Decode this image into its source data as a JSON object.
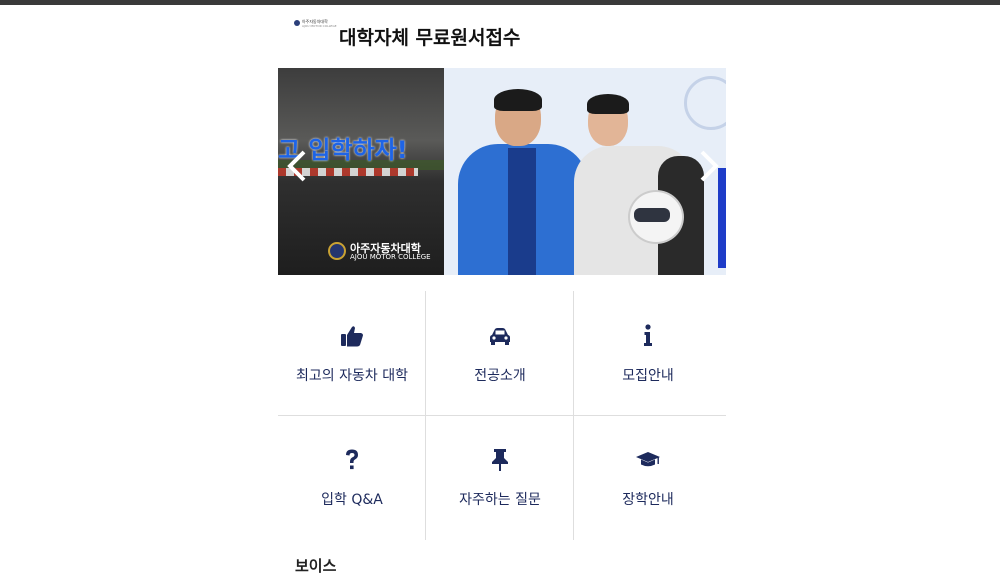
{
  "header": {
    "logo_line1": "아주자동차대학",
    "logo_line2": "AJOU MOTOR COLLEGE",
    "title": "대학자체 무료원서접수"
  },
  "banner": {
    "slogan": "고 입학하자!",
    "brand_kr": "아주자동차대학",
    "brand_en": "AJOU MOTOR COLLEGE",
    "prev_icon": "chevron-left-icon",
    "next_icon": "chevron-right-icon"
  },
  "menu": {
    "icon_color": "#1d2a5c",
    "items": [
      {
        "label": "최고의 자동차 대학",
        "icon": "thumbs-up-icon"
      },
      {
        "label": "전공소개",
        "icon": "car-icon"
      },
      {
        "label": "모집안내",
        "icon": "info-icon"
      },
      {
        "label": "입학 Q&A",
        "icon": "question-icon"
      },
      {
        "label": "자주하는 질문",
        "icon": "pin-icon"
      },
      {
        "label": "장학안내",
        "icon": "graduation-cap-icon"
      }
    ]
  },
  "section": {
    "next_heading": "보이스 "
  }
}
